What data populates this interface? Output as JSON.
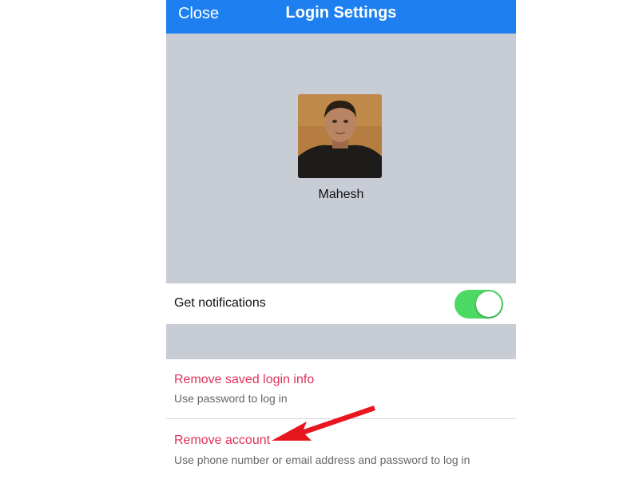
{
  "header": {
    "close_label": "Close",
    "title": "Login Settings",
    "color": "#1e80f0"
  },
  "profile": {
    "name": "Mahesh",
    "avatar_icon": "user-photo"
  },
  "notifications": {
    "label": "Get notifications",
    "enabled": true,
    "toggle_color": "#4cd964"
  },
  "options": [
    {
      "title": "Remove saved login info",
      "subtitle": "Use password to log in"
    },
    {
      "title": "Remove account",
      "subtitle": "Use phone number or email address and password to log in"
    }
  ],
  "colors": {
    "background": "#c8ccd5",
    "action_text": "#e0315a",
    "annotation_arrow": "#e8161f"
  }
}
